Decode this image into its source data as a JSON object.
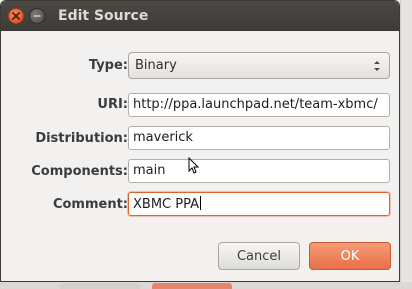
{
  "window": {
    "title": "Edit Source"
  },
  "form": {
    "type_label": "Type:",
    "type_value": "Binary",
    "uri_label": "URI:",
    "uri_value": "http://ppa.launchpad.net/team-xbmc/",
    "distribution_label": "Distribution:",
    "distribution_value": "maverick",
    "components_label": "Components:",
    "components_value": "main",
    "comment_label": "Comment:",
    "comment_value": "XBMC PPA"
  },
  "buttons": {
    "cancel_label": "Cancel",
    "ok_label": "OK"
  },
  "colors": {
    "accent": "#e8704a",
    "titlebar": "#3c3b37",
    "window_bg": "#f2f1f0"
  },
  "icons": {
    "close": "close-icon",
    "minimize": "minimize-icon",
    "combo_arrows": "up-down-arrows-icon",
    "pointer": "mouse-pointer-icon"
  }
}
